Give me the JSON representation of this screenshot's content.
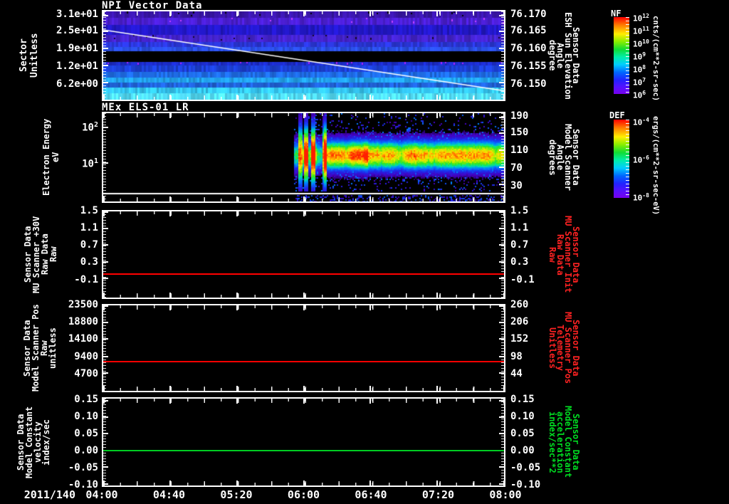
{
  "x_axis": {
    "date_label": "2011/140",
    "tick_labels": [
      "04:00",
      "04:40",
      "05:20",
      "06:00",
      "06:40",
      "07:20",
      "08:00"
    ],
    "start": "04:00",
    "end": "08:00"
  },
  "chart_data": [
    {
      "type": "heatmap",
      "title": "NPI Vector Data",
      "ylabel": "Sector\nUnitless",
      "right_label": "Sensor Data\nESH Sun Elevation\nAngle\ndegree",
      "right_label_color": "#ffffff",
      "y_ticks": [
        {
          "label": "3.1e+01",
          "frac": 0.045
        },
        {
          "label": "2.5e+01",
          "frac": 0.225
        },
        {
          "label": "1.9e+01",
          "frac": 0.42
        },
        {
          "label": "1.2e+01",
          "frac": 0.615
        },
        {
          "label": "6.2e+00",
          "frac": 0.81
        }
      ],
      "right_ticks": [
        {
          "label": "76.170",
          "frac": 0.045
        },
        {
          "label": "76.165",
          "frac": 0.225
        },
        {
          "label": "76.160",
          "frac": 0.42
        },
        {
          "label": "76.155",
          "frac": 0.615
        },
        {
          "label": "76.150",
          "frac": 0.81
        }
      ],
      "white_line": {
        "start_sector": 25.5,
        "end_sector": 3.8,
        "y0_frac": 0.21,
        "y1_frac": 0.9
      },
      "bands": [
        {
          "y0": 0.0,
          "y1": 0.075,
          "color": "#3a16aa",
          "speckle": {
            "color": "#000000",
            "density": 0.08
          }
        },
        {
          "y0": 0.075,
          "y1": 0.155,
          "color": "#4a1ed0",
          "speckle": {
            "color": "#c040ff",
            "density": 0.08
          }
        },
        {
          "y0": 0.155,
          "y1": 0.265,
          "color": "#2217c6"
        },
        {
          "y0": 0.265,
          "y1": 0.345,
          "color": "#4423cc",
          "speckle": {
            "color": "#15062a",
            "density": 0.1
          }
        },
        {
          "y0": 0.345,
          "y1": 0.4,
          "color": "#2a36d8"
        },
        {
          "y0": 0.4,
          "y1": 0.455,
          "color": "#2a4ee2"
        },
        {
          "y0": 0.455,
          "y1": 0.575,
          "color": "#000000"
        },
        {
          "y0": 0.575,
          "y1": 0.615,
          "color": "#1c2cc8",
          "speckle": {
            "color": "#aa22ff",
            "density": 0.07
          }
        },
        {
          "y0": 0.615,
          "y1": 0.685,
          "color": "#1c40d6"
        },
        {
          "y0": 0.685,
          "y1": 0.75,
          "color": "#1e6ce6"
        },
        {
          "y0": 0.75,
          "y1": 0.81,
          "color": "#22a2ee"
        },
        {
          "y0": 0.81,
          "y1": 0.865,
          "color": "#2062d8"
        },
        {
          "y0": 0.865,
          "y1": 0.925,
          "color": "#34c6f2"
        },
        {
          "y0": 0.925,
          "y1": 1.0,
          "color": "#52dcf6"
        }
      ],
      "colorbar": "NF"
    },
    {
      "type": "spectrogram",
      "title": "MEx ELS-01 LR",
      "ylabel": "Electron Energy\neV",
      "right_label": "Sensor Data\nModel Scanner\nAngle\ndegrees",
      "right_label_color": "#ffffff",
      "y_scale": "log",
      "y_ticks": [
        {
          "base": "10",
          "exp": "2",
          "frac": 0.164
        },
        {
          "base": "10",
          "exp": "1",
          "frac": 0.562
        }
      ],
      "right_ticks": [
        {
          "label": "190",
          "frac": 0.045
        },
        {
          "label": "150",
          "frac": 0.225
        },
        {
          "label": "110",
          "frac": 0.42
        },
        {
          "label": "70",
          "frac": 0.615
        },
        {
          "label": "30",
          "frac": 0.81
        }
      ],
      "data_start_time": "05:54",
      "data_start_frac": 0.476,
      "band_center_frac": 0.47,
      "band_sigma": 0.11,
      "baseline_frac": 0.9,
      "hotspots": [
        {
          "x0": 0.495,
          "x1": 0.53,
          "boost": 0.25
        },
        {
          "x0": 0.55,
          "x1": 0.66,
          "boost": 0.38
        },
        {
          "x0": 0.66,
          "x1": 0.78,
          "boost": 0.15
        },
        {
          "x0": 0.78,
          "x1": 1.0,
          "boost": 0.08
        }
      ],
      "streaks": [
        0.49,
        0.505,
        0.522,
        0.55
      ],
      "colorbar": "DEF"
    },
    {
      "type": "line",
      "ylabel": "Sensor Data\nMU Scanner +30V\nRaw Data\nRaw",
      "right_label": "Sensor Data\nMU Scanner Init\nRaw Data\nRaw",
      "right_label_color": "#ff2222",
      "y_ticks": [
        {
          "label": "1.5",
          "frac": 0.01
        },
        {
          "label": "1.1",
          "frac": 0.2
        },
        {
          "label": "0.7",
          "frac": 0.39
        },
        {
          "label": "0.3",
          "frac": 0.585
        },
        {
          "label": "-0.1",
          "frac": 0.78
        }
      ],
      "right_ticks": [
        {
          "label": "1.5",
          "frac": 0.01
        },
        {
          "label": "1.1",
          "frac": 0.2
        },
        {
          "label": "0.7",
          "frac": 0.39
        },
        {
          "label": "0.3",
          "frac": 0.585
        },
        {
          "label": "-0.1",
          "frac": 0.78
        }
      ],
      "line": {
        "color": "#ff0000",
        "value": 0.0,
        "frac": 0.73
      }
    },
    {
      "type": "line",
      "ylabel": "Sensor Data\nModel Scanner Pos\nRaw\nunitless",
      "right_label": "Sensor Data\nMU Scanner Pos\nTelemetry\nUnitless",
      "right_label_color": "#ff2222",
      "y_ticks": [
        {
          "label": "23500",
          "frac": 0.01
        },
        {
          "label": "18800",
          "frac": 0.2
        },
        {
          "label": "14100",
          "frac": 0.395
        },
        {
          "label": "9400",
          "frac": 0.6
        },
        {
          "label": "4700",
          "frac": 0.79
        }
      ],
      "right_ticks": [
        {
          "label": "260",
          "frac": 0.01
        },
        {
          "label": "206",
          "frac": 0.2
        },
        {
          "label": "152",
          "frac": 0.395
        },
        {
          "label": "98",
          "frac": 0.6
        },
        {
          "label": "44",
          "frac": 0.79
        }
      ],
      "line": {
        "color": "#ff0000",
        "value": 7900,
        "value_right_scale": 80,
        "frac": 0.66
      }
    },
    {
      "type": "line",
      "ylabel": "Sensor Data\nModel Constant\nvelocity\nindex/sec",
      "right_label": "Sensor Data\nModel Constant\nacceleration\nindex/sec**2",
      "right_label_color": "#00dd22",
      "y_ticks": [
        {
          "label": "0.15",
          "frac": 0.025
        },
        {
          "label": "0.10",
          "frac": 0.215
        },
        {
          "label": "0.05",
          "frac": 0.405
        },
        {
          "label": "0.00",
          "frac": 0.595
        },
        {
          "label": "-0.05",
          "frac": 0.785
        },
        {
          "label": "-0.10",
          "frac": 0.98
        }
      ],
      "right_ticks": [
        {
          "label": "0.15",
          "frac": 0.025
        },
        {
          "label": "0.10",
          "frac": 0.215
        },
        {
          "label": "0.05",
          "frac": 0.405
        },
        {
          "label": "0.00",
          "frac": 0.595
        },
        {
          "label": "-0.05",
          "frac": 0.785
        },
        {
          "label": "-0.10",
          "frac": 0.98
        }
      ],
      "line": {
        "color": "#00cc22",
        "value": 0.0,
        "frac": 0.595
      }
    }
  ],
  "colorbars": [
    {
      "title": "NF",
      "unit": "cnts/(cm**2-sr-sec)",
      "ticks": [
        {
          "base": "10",
          "exp": "12",
          "frac": 0.0
        },
        {
          "base": "10",
          "exp": "11",
          "frac": 0.167
        },
        {
          "base": "10",
          "exp": "10",
          "frac": 0.333
        },
        {
          "base": "10",
          "exp": "9",
          "frac": 0.5
        },
        {
          "base": "10",
          "exp": "8",
          "frac": 0.667
        },
        {
          "base": "10",
          "exp": "7",
          "frac": 0.833
        },
        {
          "base": "10",
          "exp": "6",
          "frac": 1.0
        }
      ]
    },
    {
      "title": "DEF",
      "unit": "ergs/(cm**2-sr-sec-eV)",
      "ticks": [
        {
          "base": "10",
          "exp": "-4",
          "frac": 0.02
        },
        {
          "base": "10",
          "exp": "-6",
          "frac": 0.5
        },
        {
          "base": "10",
          "exp": "-8",
          "frac": 0.98
        }
      ]
    }
  ]
}
